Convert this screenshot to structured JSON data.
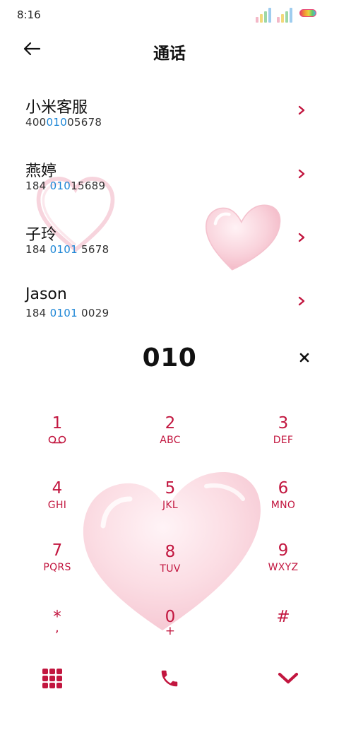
{
  "status_bar": {
    "time": "8:16"
  },
  "header": {
    "title": "通话",
    "back_icon": "arrow-left-icon"
  },
  "contacts": [
    {
      "name": "小米客服",
      "number_before": "400",
      "number_match": "010",
      "number_after": "05678"
    },
    {
      "name": "燕婷",
      "number_before": "184 ",
      "number_match": "010",
      "number_after": "15689"
    },
    {
      "name": "子玲",
      "number_before": "184 ",
      "number_match": "0101",
      "number_after": " 5678"
    },
    {
      "name": "Jason",
      "number_before": "184 ",
      "number_match": "0101",
      "number_after": " 0029"
    }
  ],
  "dialer": {
    "input": "010",
    "clear_icon": "close-icon"
  },
  "keypad": [
    {
      "digit": "1",
      "letters": ""
    },
    {
      "digit": "2",
      "letters": "ABC"
    },
    {
      "digit": "3",
      "letters": "DEF"
    },
    {
      "digit": "4",
      "letters": "GHI"
    },
    {
      "digit": "5",
      "letters": "JKL"
    },
    {
      "digit": "6",
      "letters": "MNO"
    },
    {
      "digit": "7",
      "letters": "PQRS"
    },
    {
      "digit": "8",
      "letters": "TUV"
    },
    {
      "digit": "9",
      "letters": "WXYZ"
    },
    {
      "digit": "*",
      "letters": ","
    },
    {
      "digit": "0",
      "letters": "+"
    },
    {
      "digit": "#",
      "letters": ""
    }
  ],
  "bottom_bar": {
    "keypad_icon": "grid-icon",
    "call_icon": "phone-icon",
    "collapse_icon": "chevron-down-icon"
  },
  "colors": {
    "accent": "#c2163f",
    "highlight": "#1d86d6",
    "heart": "#f9d3dc"
  }
}
